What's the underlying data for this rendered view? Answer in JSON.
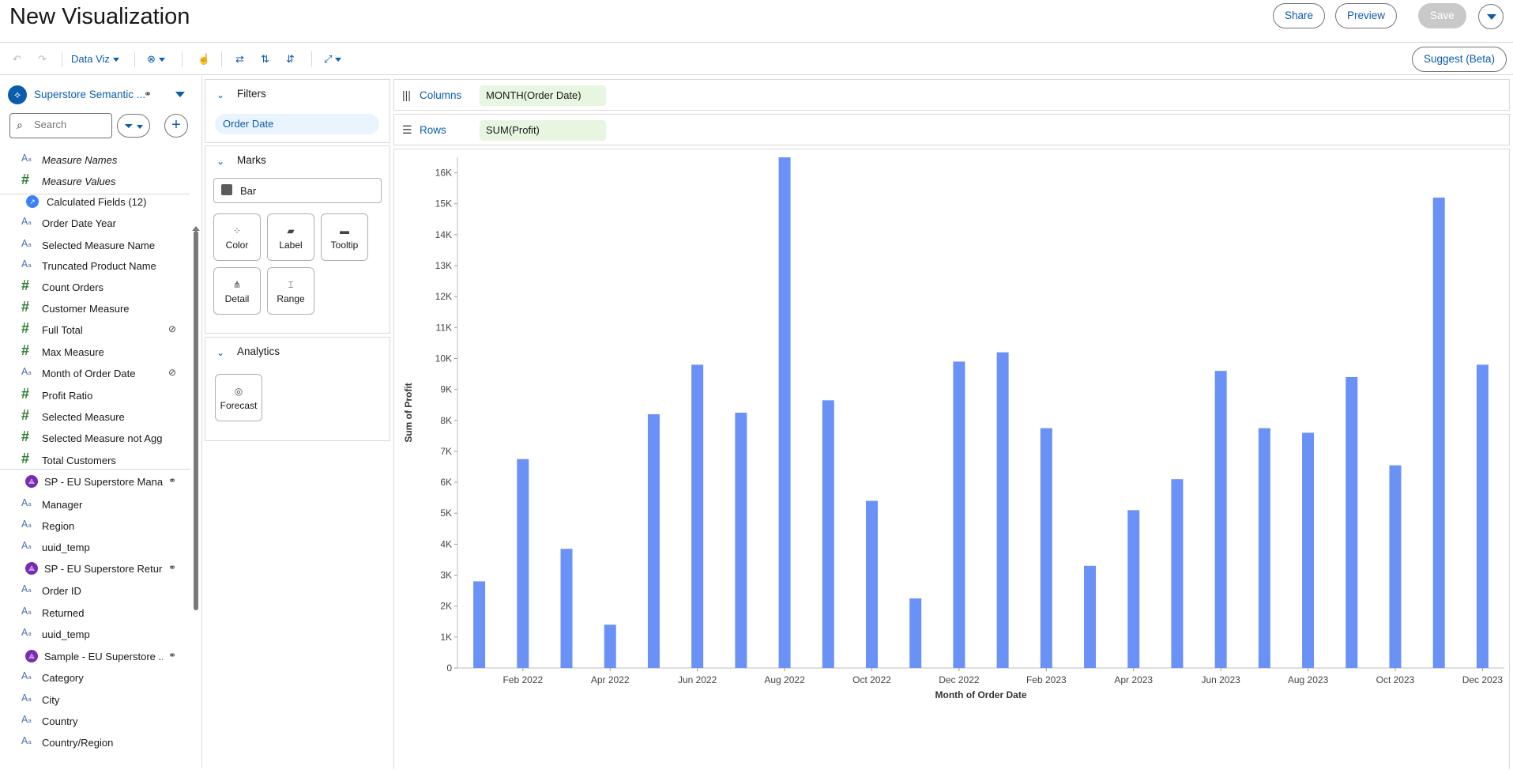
{
  "header": {
    "title": "New Visualization",
    "share_label": "Share",
    "preview_label": "Preview",
    "save_label": "Save"
  },
  "toolbar": {
    "data_viz_label": "Data Viz",
    "suggest_label": "Suggest (Beta)"
  },
  "data_pane": {
    "datasource_name": "Superstore Semantic ...",
    "search_placeholder": "Search",
    "fields": [
      {
        "type": "str",
        "label": "Measure Names",
        "italic": true
      },
      {
        "type": "hash",
        "label": "Measure Values",
        "italic": true
      },
      {
        "type": "group",
        "label": "Calculated Fields (12)"
      },
      {
        "type": "str",
        "label": "Order Date Year"
      },
      {
        "type": "str",
        "label": "Selected Measure Name"
      },
      {
        "type": "str",
        "label": "Truncated Product Name"
      },
      {
        "type": "hash",
        "label": "Count Orders"
      },
      {
        "type": "hash",
        "label": "Customer Measure"
      },
      {
        "type": "hash",
        "label": "Full Total",
        "hidden": true
      },
      {
        "type": "hash",
        "label": "Max Measure"
      },
      {
        "type": "str",
        "label": "Month of Order Date",
        "hidden": true
      },
      {
        "type": "hash",
        "label": "Profit Ratio"
      },
      {
        "type": "hash",
        "label": "Selected Measure"
      },
      {
        "type": "hash",
        "label": "Selected Measure not Agg"
      },
      {
        "type": "hash",
        "label": "Total Customers"
      },
      {
        "type": "table",
        "label": "SP - EU Superstore Mana..."
      },
      {
        "type": "str",
        "label": "Manager"
      },
      {
        "type": "str",
        "label": "Region"
      },
      {
        "type": "str",
        "label": "uuid_temp"
      },
      {
        "type": "table",
        "label": "SP - EU Superstore Retur..."
      },
      {
        "type": "str",
        "label": "Order ID"
      },
      {
        "type": "str",
        "label": "Returned"
      },
      {
        "type": "str",
        "label": "uuid_temp"
      },
      {
        "type": "table",
        "label": "Sample - EU Superstore ..."
      },
      {
        "type": "str",
        "label": "Category"
      },
      {
        "type": "str",
        "label": "City"
      },
      {
        "type": "str",
        "label": "Country"
      },
      {
        "type": "str",
        "label": "Country/Region"
      }
    ]
  },
  "filters": {
    "title": "Filters",
    "items": [
      "Order Date"
    ]
  },
  "marks": {
    "title": "Marks",
    "mark_type": "Bar",
    "cards": [
      "Color",
      "Label",
      "Tooltip",
      "Detail",
      "Range"
    ]
  },
  "analytics": {
    "title": "Analytics",
    "cards": [
      "Forecast"
    ]
  },
  "shelves": {
    "columns_label": "Columns",
    "columns_pill": "MONTH(Order Date)",
    "rows_label": "Rows",
    "rows_pill": "SUM(Profit)"
  },
  "colors": {
    "accent": "#0b5cab",
    "bar": "#6a91f6"
  },
  "chart_data": {
    "type": "bar",
    "xlabel": "Month of Order Date",
    "ylabel": "Sum of Profit",
    "ylim": [
      0,
      16500
    ],
    "yticks": [
      0,
      1000,
      2000,
      3000,
      4000,
      5000,
      6000,
      7000,
      8000,
      9000,
      10000,
      11000,
      12000,
      13000,
      14000,
      15000,
      16000
    ],
    "ytick_labels": [
      "0",
      "1K",
      "2K",
      "3K",
      "4K",
      "5K",
      "6K",
      "7K",
      "8K",
      "9K",
      "10K",
      "11K",
      "12K",
      "13K",
      "14K",
      "15K",
      "16K"
    ],
    "categories": [
      "Jan 2022",
      "Feb 2022",
      "Mar 2022",
      "Apr 2022",
      "May 2022",
      "Jun 2022",
      "Jul 2022",
      "Aug 2022",
      "Sep 2022",
      "Oct 2022",
      "Nov 2022",
      "Dec 2022",
      "Jan 2023",
      "Feb 2023",
      "Mar 2023",
      "Apr 2023",
      "May 2023",
      "Jun 2023",
      "Jul 2023",
      "Aug 2023",
      "Sep 2023",
      "Oct 2023",
      "Nov 2023",
      "Dec 2023"
    ],
    "visible_tick_labels": [
      "Feb 2022",
      "Apr 2022",
      "Jun 2022",
      "Aug 2022",
      "Oct 2022",
      "Dec 2022",
      "Feb 2023",
      "Apr 2023",
      "Jun 2023",
      "Aug 2023",
      "Oct 2023",
      "Dec 2023"
    ],
    "values": [
      2800,
      6750,
      3850,
      1400,
      8200,
      9800,
      8250,
      16500,
      8650,
      5400,
      2250,
      9900,
      10200,
      7750,
      3300,
      5100,
      6100,
      9600,
      7750,
      7600,
      9400,
      6550,
      15200,
      9800
    ]
  }
}
